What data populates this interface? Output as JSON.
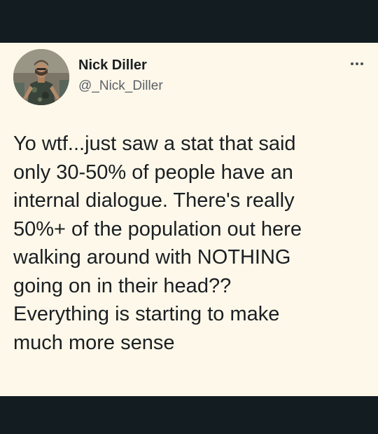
{
  "tweet": {
    "author": {
      "name": "Nick Diller",
      "handle": "@_Nick_Diller",
      "avatar_icon": "profile-photo"
    },
    "more_icon": "more-options-icon",
    "text": "Yo wtf...just saw a stat that said\nonly 30-50% of people have an\ninternal dialogue.  There's really\n50%+ of the population out here\nwalking around with NOTHING\ngoing on in their head??\nEverything is starting to make\nmuch more sense"
  },
  "colors": {
    "background": "#121c21",
    "card": "#fdf8ea",
    "text": "#1b1f22",
    "handle": "#5c6166"
  }
}
